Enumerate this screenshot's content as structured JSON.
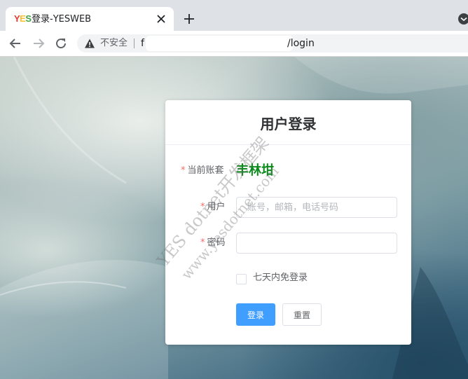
{
  "browser": {
    "tab_title": "登录-YESWEB",
    "favicon_text": [
      "Y",
      "E",
      "S"
    ],
    "security_label": "不安全",
    "url_prefix": "f",
    "url_suffix": "/login"
  },
  "login": {
    "title": "用户登录",
    "account_label": "当前账套",
    "account_value": "丰林坩",
    "user_label": "用户",
    "user_placeholder": "账号，邮箱，电话号码",
    "password_label": "密码",
    "remember_label": "七天内免登录",
    "login_button": "登录",
    "reset_button": "重置"
  },
  "watermark": {
    "line1": "YES dotnet开发框架",
    "line2": "www.yesdotnet.com"
  },
  "colors": {
    "primary": "#409eff",
    "account_value": "#0a8a1a",
    "required": "#f56c6c"
  },
  "icons": [
    "back-arrow-icon",
    "forward-arrow-icon",
    "reload-icon",
    "warning-icon",
    "close-icon",
    "plus-icon",
    "tab-search-icon"
  ]
}
